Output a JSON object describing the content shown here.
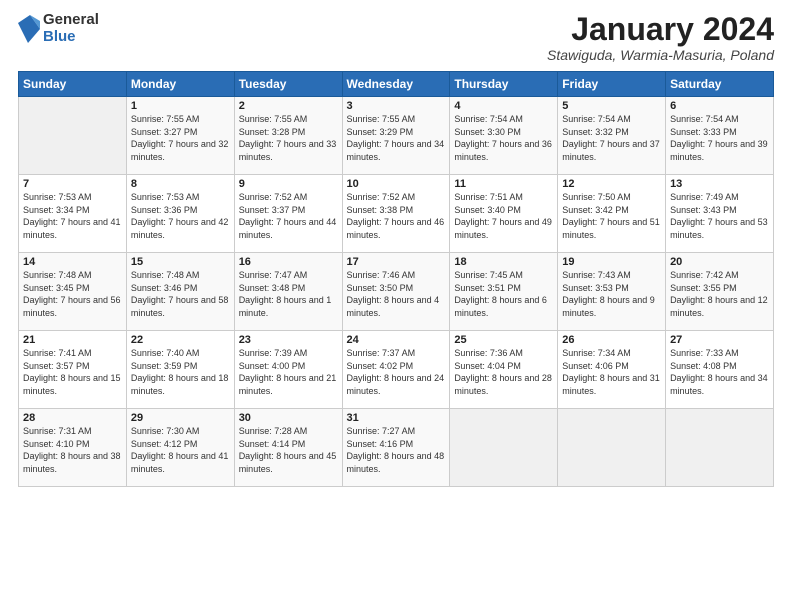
{
  "logo": {
    "general": "General",
    "blue": "Blue"
  },
  "title": "January 2024",
  "subtitle": "Stawiguda, Warmia-Masuria, Poland",
  "days_header": [
    "Sunday",
    "Monday",
    "Tuesday",
    "Wednesday",
    "Thursday",
    "Friday",
    "Saturday"
  ],
  "weeks": [
    [
      {
        "num": "",
        "sunrise": "",
        "sunset": "",
        "daylight": "",
        "empty": true
      },
      {
        "num": "1",
        "sunrise": "Sunrise: 7:55 AM",
        "sunset": "Sunset: 3:27 PM",
        "daylight": "Daylight: 7 hours and 32 minutes."
      },
      {
        "num": "2",
        "sunrise": "Sunrise: 7:55 AM",
        "sunset": "Sunset: 3:28 PM",
        "daylight": "Daylight: 7 hours and 33 minutes."
      },
      {
        "num": "3",
        "sunrise": "Sunrise: 7:55 AM",
        "sunset": "Sunset: 3:29 PM",
        "daylight": "Daylight: 7 hours and 34 minutes."
      },
      {
        "num": "4",
        "sunrise": "Sunrise: 7:54 AM",
        "sunset": "Sunset: 3:30 PM",
        "daylight": "Daylight: 7 hours and 36 minutes."
      },
      {
        "num": "5",
        "sunrise": "Sunrise: 7:54 AM",
        "sunset": "Sunset: 3:32 PM",
        "daylight": "Daylight: 7 hours and 37 minutes."
      },
      {
        "num": "6",
        "sunrise": "Sunrise: 7:54 AM",
        "sunset": "Sunset: 3:33 PM",
        "daylight": "Daylight: 7 hours and 39 minutes."
      }
    ],
    [
      {
        "num": "7",
        "sunrise": "Sunrise: 7:53 AM",
        "sunset": "Sunset: 3:34 PM",
        "daylight": "Daylight: 7 hours and 41 minutes."
      },
      {
        "num": "8",
        "sunrise": "Sunrise: 7:53 AM",
        "sunset": "Sunset: 3:36 PM",
        "daylight": "Daylight: 7 hours and 42 minutes."
      },
      {
        "num": "9",
        "sunrise": "Sunrise: 7:52 AM",
        "sunset": "Sunset: 3:37 PM",
        "daylight": "Daylight: 7 hours and 44 minutes."
      },
      {
        "num": "10",
        "sunrise": "Sunrise: 7:52 AM",
        "sunset": "Sunset: 3:38 PM",
        "daylight": "Daylight: 7 hours and 46 minutes."
      },
      {
        "num": "11",
        "sunrise": "Sunrise: 7:51 AM",
        "sunset": "Sunset: 3:40 PM",
        "daylight": "Daylight: 7 hours and 49 minutes."
      },
      {
        "num": "12",
        "sunrise": "Sunrise: 7:50 AM",
        "sunset": "Sunset: 3:42 PM",
        "daylight": "Daylight: 7 hours and 51 minutes."
      },
      {
        "num": "13",
        "sunrise": "Sunrise: 7:49 AM",
        "sunset": "Sunset: 3:43 PM",
        "daylight": "Daylight: 7 hours and 53 minutes."
      }
    ],
    [
      {
        "num": "14",
        "sunrise": "Sunrise: 7:48 AM",
        "sunset": "Sunset: 3:45 PM",
        "daylight": "Daylight: 7 hours and 56 minutes."
      },
      {
        "num": "15",
        "sunrise": "Sunrise: 7:48 AM",
        "sunset": "Sunset: 3:46 PM",
        "daylight": "Daylight: 7 hours and 58 minutes."
      },
      {
        "num": "16",
        "sunrise": "Sunrise: 7:47 AM",
        "sunset": "Sunset: 3:48 PM",
        "daylight": "Daylight: 8 hours and 1 minute."
      },
      {
        "num": "17",
        "sunrise": "Sunrise: 7:46 AM",
        "sunset": "Sunset: 3:50 PM",
        "daylight": "Daylight: 8 hours and 4 minutes."
      },
      {
        "num": "18",
        "sunrise": "Sunrise: 7:45 AM",
        "sunset": "Sunset: 3:51 PM",
        "daylight": "Daylight: 8 hours and 6 minutes."
      },
      {
        "num": "19",
        "sunrise": "Sunrise: 7:43 AM",
        "sunset": "Sunset: 3:53 PM",
        "daylight": "Daylight: 8 hours and 9 minutes."
      },
      {
        "num": "20",
        "sunrise": "Sunrise: 7:42 AM",
        "sunset": "Sunset: 3:55 PM",
        "daylight": "Daylight: 8 hours and 12 minutes."
      }
    ],
    [
      {
        "num": "21",
        "sunrise": "Sunrise: 7:41 AM",
        "sunset": "Sunset: 3:57 PM",
        "daylight": "Daylight: 8 hours and 15 minutes."
      },
      {
        "num": "22",
        "sunrise": "Sunrise: 7:40 AM",
        "sunset": "Sunset: 3:59 PM",
        "daylight": "Daylight: 8 hours and 18 minutes."
      },
      {
        "num": "23",
        "sunrise": "Sunrise: 7:39 AM",
        "sunset": "Sunset: 4:00 PM",
        "daylight": "Daylight: 8 hours and 21 minutes."
      },
      {
        "num": "24",
        "sunrise": "Sunrise: 7:37 AM",
        "sunset": "Sunset: 4:02 PM",
        "daylight": "Daylight: 8 hours and 24 minutes."
      },
      {
        "num": "25",
        "sunrise": "Sunrise: 7:36 AM",
        "sunset": "Sunset: 4:04 PM",
        "daylight": "Daylight: 8 hours and 28 minutes."
      },
      {
        "num": "26",
        "sunrise": "Sunrise: 7:34 AM",
        "sunset": "Sunset: 4:06 PM",
        "daylight": "Daylight: 8 hours and 31 minutes."
      },
      {
        "num": "27",
        "sunrise": "Sunrise: 7:33 AM",
        "sunset": "Sunset: 4:08 PM",
        "daylight": "Daylight: 8 hours and 34 minutes."
      }
    ],
    [
      {
        "num": "28",
        "sunrise": "Sunrise: 7:31 AM",
        "sunset": "Sunset: 4:10 PM",
        "daylight": "Daylight: 8 hours and 38 minutes."
      },
      {
        "num": "29",
        "sunrise": "Sunrise: 7:30 AM",
        "sunset": "Sunset: 4:12 PM",
        "daylight": "Daylight: 8 hours and 41 minutes."
      },
      {
        "num": "30",
        "sunrise": "Sunrise: 7:28 AM",
        "sunset": "Sunset: 4:14 PM",
        "daylight": "Daylight: 8 hours and 45 minutes."
      },
      {
        "num": "31",
        "sunrise": "Sunrise: 7:27 AM",
        "sunset": "Sunset: 4:16 PM",
        "daylight": "Daylight: 8 hours and 48 minutes."
      },
      {
        "num": "",
        "sunrise": "",
        "sunset": "",
        "daylight": "",
        "empty": true
      },
      {
        "num": "",
        "sunrise": "",
        "sunset": "",
        "daylight": "",
        "empty": true
      },
      {
        "num": "",
        "sunrise": "",
        "sunset": "",
        "daylight": "",
        "empty": true
      }
    ]
  ]
}
